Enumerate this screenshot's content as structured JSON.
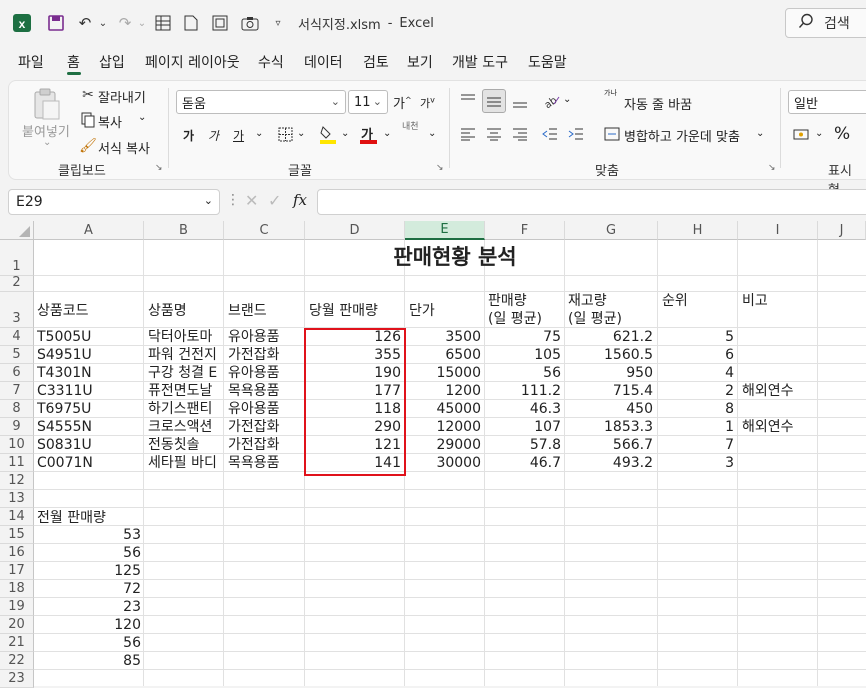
{
  "titlebar": {
    "filename": "서식지정.xlsm",
    "separator": "-",
    "app": "Excel",
    "search_label": "검색"
  },
  "menu": [
    "파일",
    "홈",
    "삽입",
    "페이지 레이아웃",
    "수식",
    "데이터",
    "검토",
    "보기",
    "개발 도구",
    "도움말"
  ],
  "ribbon": {
    "clipboard": {
      "paste": "붙여넣기",
      "cut": "잘라내기",
      "copy": "복사",
      "format_painter": "서식 복사",
      "group": "클립보드"
    },
    "font": {
      "name": "돋움",
      "size": "11",
      "bold": "가",
      "italic": "가",
      "underline": "가",
      "font_color_glyph": "가",
      "phonetic": "내천",
      "grow": "가",
      "shrink": "가",
      "group": "글꼴"
    },
    "alignment": {
      "wrap": "자동 줄 바꿈",
      "merge": "병합하고 가운데 맞춤",
      "wrap_icon_text": "가나",
      "group": "맞춤"
    },
    "number": {
      "format": "일반",
      "percent": "%",
      "group": "표시 형"
    }
  },
  "formula_bar": {
    "name_box": "E29",
    "fx": "fx",
    "value": ""
  },
  "columns": [
    "A",
    "B",
    "C",
    "D",
    "E",
    "F",
    "G",
    "H",
    "I",
    "J"
  ],
  "rows": [
    "1",
    "2",
    "3",
    "4",
    "5",
    "6",
    "7",
    "8",
    "9",
    "10",
    "11",
    "12",
    "13",
    "14",
    "15",
    "16",
    "17",
    "18",
    "19",
    "20",
    "21",
    "22",
    "23"
  ],
  "sheet": {
    "title": "판매현황 분석",
    "headers": {
      "a": "상품코드",
      "b": "상품명",
      "c": "브랜드",
      "d": "당월 판매량",
      "e": "단가",
      "f1": "판매량",
      "f2": "(일 평균)",
      "g1": "재고량",
      "g2": "(일 평균)",
      "h": "순위",
      "i": "비고"
    },
    "data": [
      {
        "code": "T5005U",
        "name": "닥터아토마",
        "brand": "유아용품",
        "qty": "126",
        "price": "3500",
        "avg": "75",
        "stock": "621.2",
        "rank": "5",
        "note": ""
      },
      {
        "code": "S4951U",
        "name": "파워 건전지",
        "brand": "가전잡화",
        "qty": "355",
        "price": "6500",
        "avg": "105",
        "stock": "1560.5",
        "rank": "6",
        "note": ""
      },
      {
        "code": "T4301N",
        "name": "구강 청결 E",
        "brand": "유아용품",
        "qty": "190",
        "price": "15000",
        "avg": "56",
        "stock": "950",
        "rank": "4",
        "note": ""
      },
      {
        "code": "C3311U",
        "name": "퓨전면도날",
        "brand": "목욕용품",
        "qty": "177",
        "price": "1200",
        "avg": "111.2",
        "stock": "715.4",
        "rank": "2",
        "note": "해외연수"
      },
      {
        "code": "T6975U",
        "name": "하기스팬티",
        "brand": "유아용품",
        "qty": "118",
        "price": "45000",
        "avg": "46.3",
        "stock": "450",
        "rank": "8",
        "note": ""
      },
      {
        "code": "S4555N",
        "name": "크로스액션",
        "brand": "가전잡화",
        "qty": "290",
        "price": "12000",
        "avg": "107",
        "stock": "1853.3",
        "rank": "1",
        "note": "해외연수"
      },
      {
        "code": "S0831U",
        "name": "전동칫솔",
        "brand": "가전잡화",
        "qty": "121",
        "price": "29000",
        "avg": "57.8",
        "stock": "566.7",
        "rank": "7",
        "note": ""
      },
      {
        "code": "C0071N",
        "name": "세타필 바디",
        "brand": "목욕용품",
        "qty": "141",
        "price": "30000",
        "avg": "46.7",
        "stock": "493.2",
        "rank": "3",
        "note": ""
      }
    ],
    "prev_label": "전월 판매량",
    "prev_values": [
      "53",
      "56",
      "125",
      "72",
      "23",
      "120",
      "56",
      "85"
    ]
  }
}
